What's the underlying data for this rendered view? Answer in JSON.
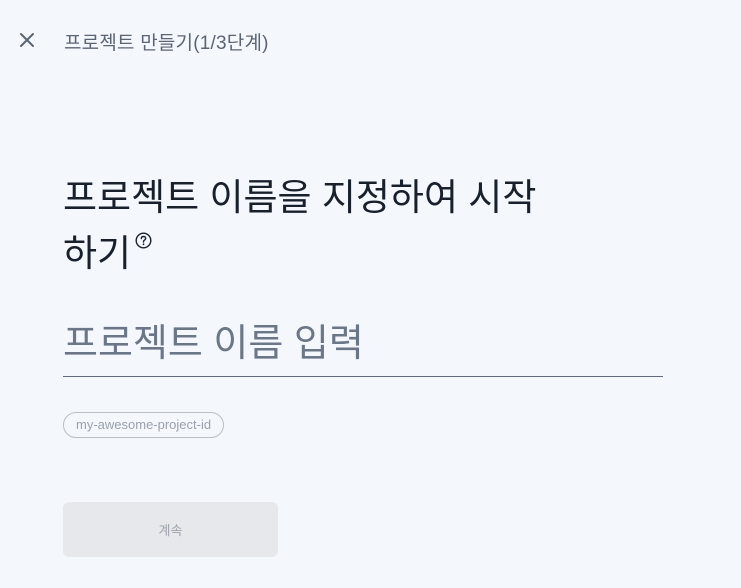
{
  "header": {
    "close_icon": "close-icon",
    "step_title": "프로젝트 만들기(1/3단계)"
  },
  "main": {
    "heading": "프로젝트 이름을 지정하여 시작하기",
    "help_icon": "help-circle-icon",
    "name_input": {
      "value": "",
      "placeholder": "프로젝트 이름 입력"
    },
    "project_id_chip": "my-awesome-project-id",
    "continue_label": "계속"
  },
  "colors": {
    "background": "#f4f8fd",
    "heading_text": "#17202b",
    "secondary_text": "#5b6472",
    "button_disabled_bg": "#e6e8ec",
    "button_disabled_text": "#9ea3ab"
  }
}
